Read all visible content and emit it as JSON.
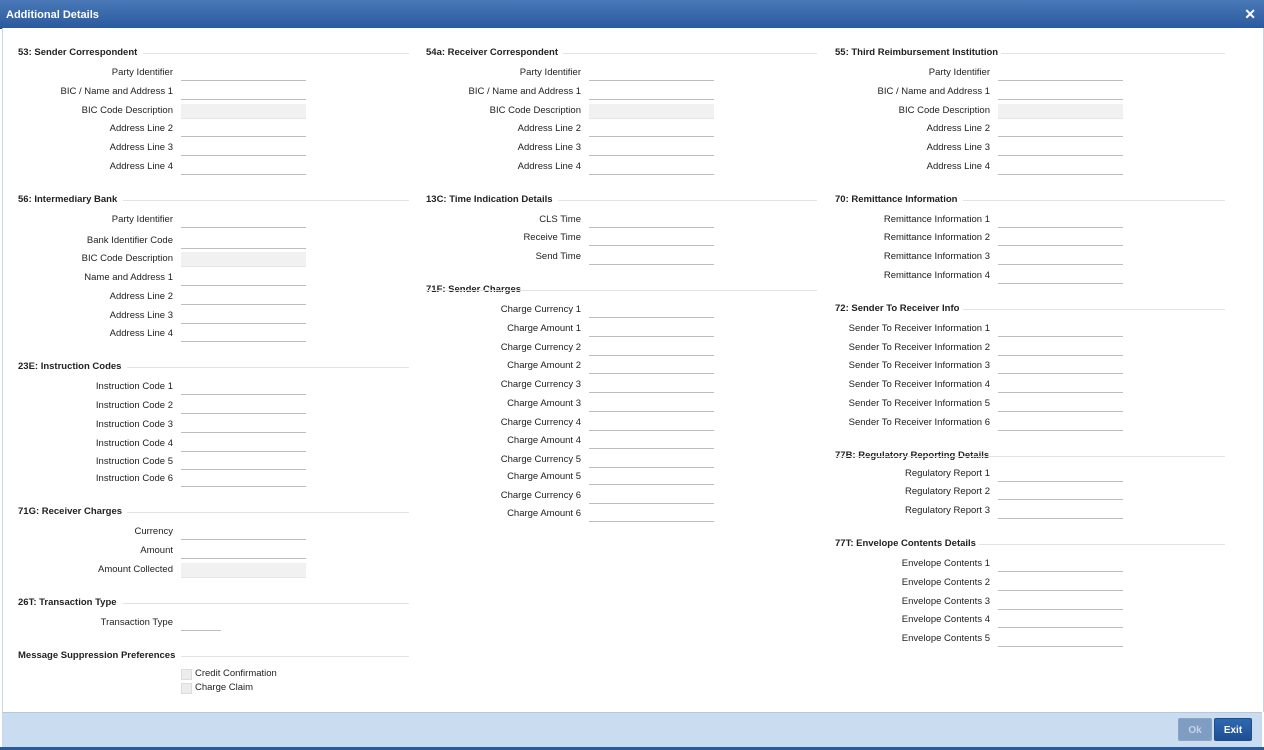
{
  "window": {
    "title": "Additional Details"
  },
  "sections": {
    "s53": {
      "title": "53: Sender Correspondent",
      "fields": [
        "Party Identifier",
        "BIC / Name and Address 1",
        "BIC Code Description",
        "Address Line 2",
        "Address Line 3",
        "Address Line 4"
      ]
    },
    "s54a": {
      "title": "54a: Receiver Correspondent",
      "fields": [
        "Party Identifier",
        "BIC / Name and Address 1",
        "BIC Code Description",
        "Address Line 2",
        "Address Line 3",
        "Address Line 4"
      ]
    },
    "s55": {
      "title": "55: Third Reimbursement Institution",
      "fields": [
        "Party Identifier",
        "BIC / Name and Address 1",
        "BIC Code Description",
        "Address Line 2",
        "Address Line 3",
        "Address Line 4"
      ]
    },
    "s56": {
      "title": "56: Intermediary Bank",
      "fields": [
        "Party Identifier",
        "Bank Identifier Code",
        "BIC Code Description",
        "Name and Address 1",
        "Address Line 2",
        "Address Line 3",
        "Address Line 4"
      ]
    },
    "s13c": {
      "title": "13C: Time Indication Details",
      "fields": [
        "CLS Time",
        "Receive Time",
        "Send Time"
      ]
    },
    "s70": {
      "title": "70: Remittance Information",
      "fields": [
        "Remittance Information 1",
        "Remittance Information 2",
        "Remittance Information 3",
        "Remittance Information 4"
      ]
    },
    "s71f": {
      "title": "71F: Sender Charges",
      "fields": [
        "Charge Currency 1",
        "Charge Amount 1",
        "Charge Currency 2",
        "Charge Amount 2",
        "Charge Currency 3",
        "Charge Amount 3",
        "Charge Currency 4",
        "Charge Amount 4",
        "Charge Currency 5",
        "Charge Amount 5",
        "Charge Currency 6",
        "Charge Amount 6"
      ]
    },
    "s72": {
      "title": "72: Sender To Receiver Info",
      "fields": [
        "Sender To Receiver Information 1",
        "Sender To Receiver Information 2",
        "Sender To Receiver Information 3",
        "Sender To Receiver Information 4",
        "Sender To Receiver Information 5",
        "Sender To Receiver Information 6"
      ]
    },
    "s23e": {
      "title": "23E: Instruction Codes",
      "fields": [
        "Instruction Code 1",
        "Instruction Code 2",
        "Instruction Code 3",
        "Instruction Code 4",
        "Instruction Code 5",
        "Instruction Code 6"
      ]
    },
    "s77b": {
      "title": "77B: Regulatory Reporting Details",
      "fields": [
        "Regulatory Report 1",
        "Regulatory Report 2",
        "Regulatory Report 3"
      ]
    },
    "s71g": {
      "title": "71G: Receiver Charges",
      "fields": [
        "Currency",
        "Amount",
        "Amount Collected"
      ]
    },
    "s77t": {
      "title": "77T: Envelope Contents Details",
      "fields": [
        "Envelope Contents 1",
        "Envelope Contents 2",
        "Envelope Contents 3",
        "Envelope Contents 4",
        "Envelope Contents 5"
      ]
    },
    "s26t": {
      "title": "26T: Transaction Type",
      "fields": [
        "Transaction Type"
      ]
    },
    "msp": {
      "title": "Message Suppression Preferences",
      "checkboxes": [
        "Credit Confirmation",
        "Charge Claim"
      ]
    }
  },
  "footer": {
    "ok_label": "Ok",
    "exit_label": "Exit"
  }
}
